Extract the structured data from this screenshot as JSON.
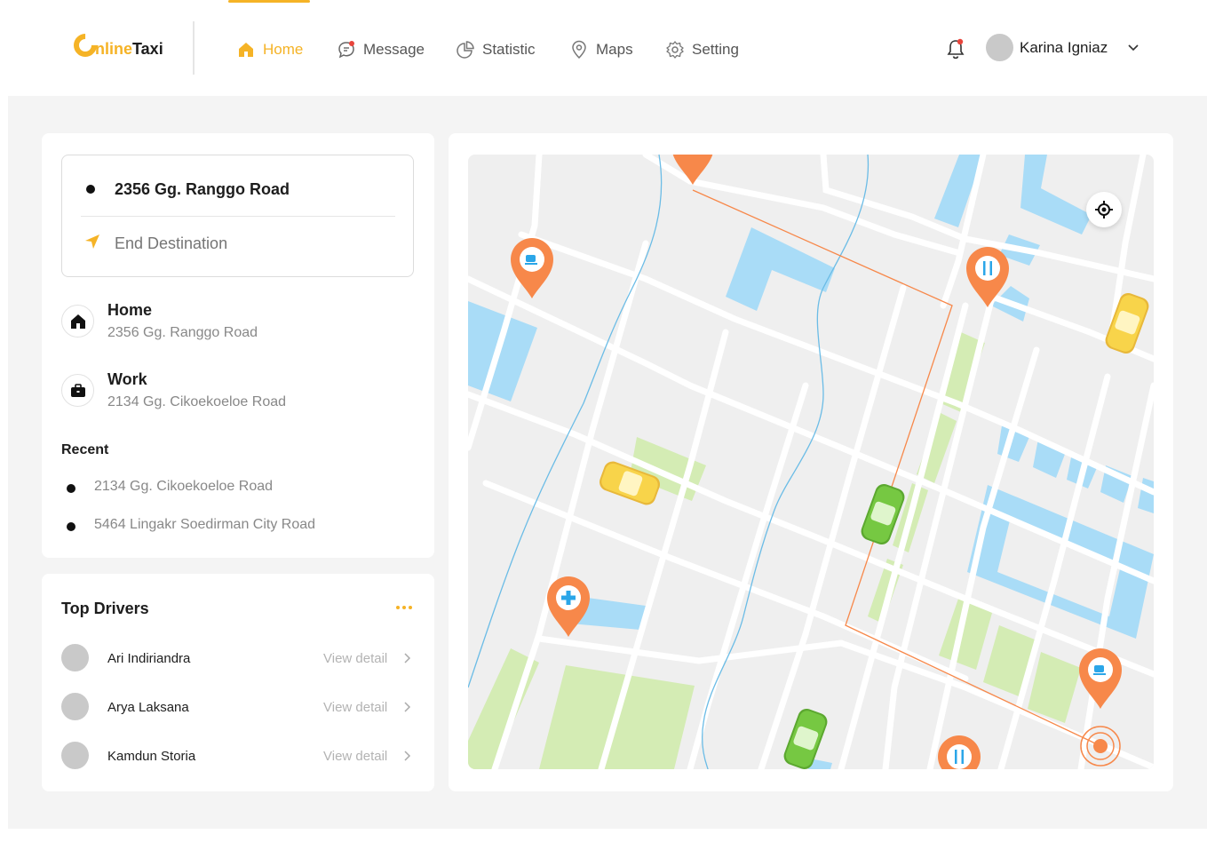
{
  "brand": {
    "logo_part1": "nline",
    "logo_part2": "Taxi"
  },
  "nav": {
    "items": [
      {
        "label": "Home",
        "icon": "home-icon"
      },
      {
        "label": "Message",
        "icon": "message-icon"
      },
      {
        "label": "Statistic",
        "icon": "pie-chart-icon"
      },
      {
        "label": "Maps",
        "icon": "map-pin-icon"
      },
      {
        "label": "Setting",
        "icon": "gear-icon"
      }
    ]
  },
  "user": {
    "name": "Karina Igniaz"
  },
  "route": {
    "from": "2356 Gg. Ranggo Road",
    "destination_placeholder": "End Destination"
  },
  "saved_places": [
    {
      "title": "Home",
      "address": "2356 Gg. Ranggo Road",
      "icon": "home-icon"
    },
    {
      "title": "Work",
      "address": "2134 Gg. Cikoekoeloe Road",
      "icon": "briefcase-icon"
    }
  ],
  "recent": {
    "heading": "Recent",
    "items": [
      "2134 Gg. Cikoekoeloe Road",
      "5464 Lingakr Soedirman City Road"
    ]
  },
  "drivers": {
    "heading": "Top Drivers",
    "link_label": "View detail",
    "items": [
      {
        "name": "Ari Indiriandra"
      },
      {
        "name": "Arya Laksana"
      },
      {
        "name": "Kamdun Storia"
      }
    ]
  },
  "colors": {
    "accent": "#f5b326",
    "pin": "#f7884a",
    "water": "#a9dcf7",
    "park": "#d4ecb4",
    "car_yellow": "#f8d44a",
    "car_green": "#76c842"
  }
}
